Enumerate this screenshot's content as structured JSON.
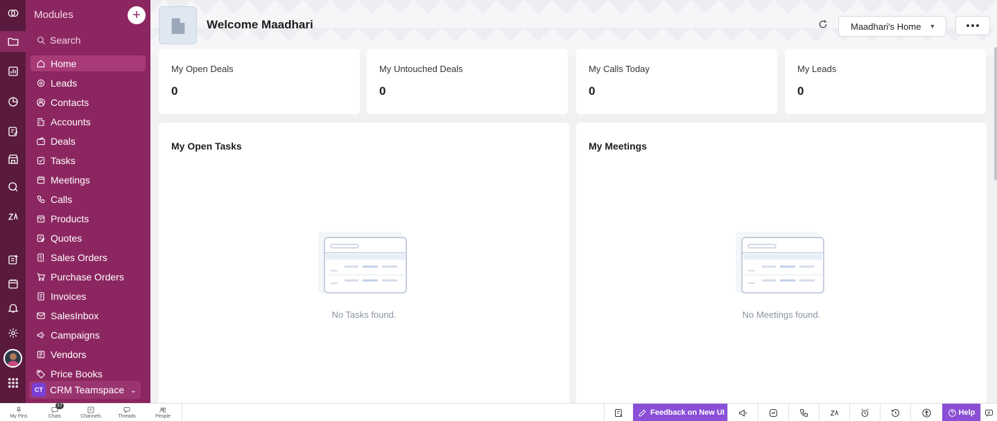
{
  "sidebar": {
    "title": "Modules",
    "add_label": "+",
    "search_placeholder": "Search",
    "items": [
      {
        "label": "Home",
        "icon": "home-icon"
      },
      {
        "label": "Leads",
        "icon": "target-icon"
      },
      {
        "label": "Contacts",
        "icon": "contact-icon"
      },
      {
        "label": "Accounts",
        "icon": "building-icon"
      },
      {
        "label": "Deals",
        "icon": "wallet-icon"
      },
      {
        "label": "Tasks",
        "icon": "task-icon"
      },
      {
        "label": "Meetings",
        "icon": "calendar-icon"
      },
      {
        "label": "Calls",
        "icon": "phone-icon"
      },
      {
        "label": "Products",
        "icon": "box-icon"
      },
      {
        "label": "Quotes",
        "icon": "quote-icon"
      },
      {
        "label": "Sales Orders",
        "icon": "sales-order-icon"
      },
      {
        "label": "Purchase Orders",
        "icon": "cart-icon"
      },
      {
        "label": "Invoices",
        "icon": "invoice-icon"
      },
      {
        "label": "SalesInbox",
        "icon": "inbox-icon"
      },
      {
        "label": "Campaigns",
        "icon": "megaphone-icon"
      },
      {
        "label": "Vendors",
        "icon": "vendor-icon"
      },
      {
        "label": "Price Books",
        "icon": "tag-icon"
      }
    ],
    "active_index": 0,
    "teamspace": {
      "badge": "CT",
      "label": "CRM Teamspace"
    }
  },
  "header": {
    "welcome": "Welcome Maadhari",
    "home_select": "Maadhari's Home"
  },
  "stats": [
    {
      "label": "My Open Deals",
      "value": "0"
    },
    {
      "label": "My Untouched Deals",
      "value": "0"
    },
    {
      "label": "My Calls Today",
      "value": "0"
    },
    {
      "label": "My Leads",
      "value": "0"
    }
  ],
  "panels": [
    {
      "title": "My Open Tasks",
      "empty": "No Tasks found."
    },
    {
      "title": "My Meetings",
      "empty": "No Meetings found."
    }
  ],
  "bottom_bar": {
    "left": [
      {
        "label": "My Pins",
        "icon": "pin-icon"
      },
      {
        "label": "Chats",
        "icon": "chat-icon"
      },
      {
        "label": "Channels",
        "icon": "channel-icon"
      },
      {
        "label": "Threads",
        "icon": "thread-icon"
      },
      {
        "label": "People",
        "icon": "people-icon"
      }
    ],
    "chat_badge": "17",
    "feedback": "Feedback on New UI",
    "help": "Help"
  },
  "colors": {
    "rail": "#5a1a3e",
    "sidebar": "#8c2660",
    "accent": "#8a4fd6"
  }
}
